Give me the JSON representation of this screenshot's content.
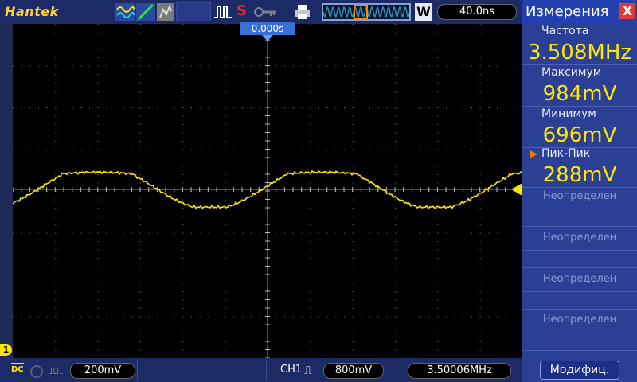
{
  "header": {
    "brand": "Hantek",
    "trigger_mode": "S",
    "acquisition_badge": "W",
    "timebase": "40.0ns",
    "icons": [
      "wave-mode-icon",
      "cursor-icon",
      "persist-icon",
      "pulse-icon",
      "key-icon",
      "printer-icon"
    ]
  },
  "plot": {
    "trigger_time": "0.000s",
    "channel_marker": "1",
    "colors": {
      "trace": "#ffe600",
      "grid": "#6e6e6e",
      "background": "#000000"
    }
  },
  "footer": {
    "coupling": "DC",
    "ch1_scale": "200mV",
    "trigger_source": "CH1",
    "trigger_level": "800mV",
    "frequency": "3.50006MHz"
  },
  "measurements": {
    "title": "Измерения",
    "close": "X",
    "items": [
      {
        "label": "Частота",
        "value": "3.508MHz"
      },
      {
        "label": "Максимум",
        "value": "984mV"
      },
      {
        "label": "Минимум",
        "value": "696mV"
      },
      {
        "label": "Пик-Пик",
        "value": "288mV"
      }
    ],
    "undefined_label": "Неопределен",
    "modify_button": "Модифиц."
  }
}
